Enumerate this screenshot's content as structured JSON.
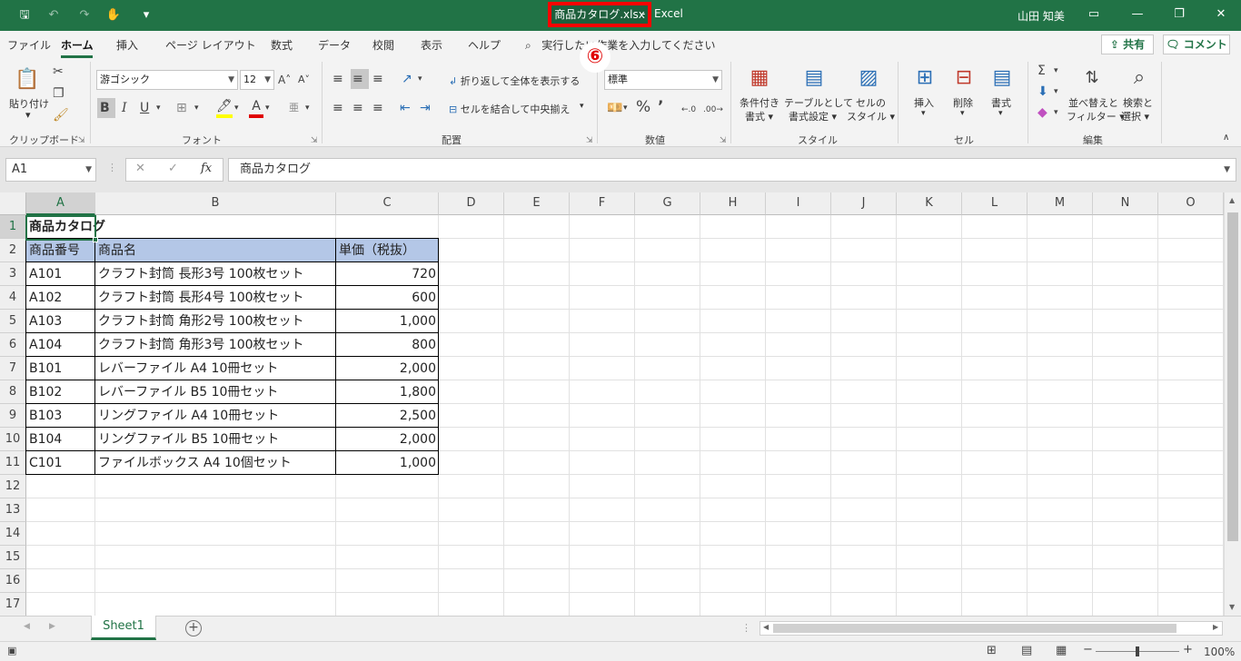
{
  "titlebar": {
    "file_name": "商品カタログ.xlsx",
    "separator": "-",
    "app_name": "Excel",
    "user": "山田 知美"
  },
  "menu": {
    "tabs": [
      "ファイル",
      "ホーム",
      "挿入",
      "ページ レイアウト",
      "数式",
      "データ",
      "校閲",
      "表示",
      "ヘルプ"
    ],
    "active_tab": "ホーム",
    "tell_me": "実行したい作業を入力してください",
    "share": "共有",
    "comment": "コメント",
    "step_marker": "⑥"
  },
  "ribbon": {
    "clipboard": {
      "paste": "貼り付け",
      "label": "クリップボード"
    },
    "font": {
      "name": "游ゴシック",
      "size": "12",
      "bold": "B",
      "italic": "I",
      "underline": "U",
      "label": "フォント"
    },
    "alignment": {
      "wrap": "折り返して全体を表示する",
      "merge": "セルを結合して中央揃え",
      "label": "配置"
    },
    "number": {
      "format": "標準",
      "label": "数値"
    },
    "styles": {
      "conditional": [
        "条件付き",
        "書式"
      ],
      "table": [
        "テーブルとして",
        "書式設定"
      ],
      "cell": [
        "セルの",
        "スタイル"
      ],
      "label": "スタイル"
    },
    "cells": {
      "insert": "挿入",
      "delete": "削除",
      "format": "書式",
      "label": "セル"
    },
    "editing": {
      "sort": [
        "並べ替えと",
        "フィルター"
      ],
      "find": [
        "検索と",
        "選択"
      ],
      "label": "編集"
    }
  },
  "formula_bar": {
    "name_box": "A1",
    "fx": "fx",
    "value": "商品カタログ"
  },
  "columns": [
    "A",
    "B",
    "C",
    "D",
    "E",
    "F",
    "G",
    "H",
    "I",
    "J",
    "K",
    "L",
    "M",
    "N",
    "O"
  ],
  "rows": [
    "1",
    "2",
    "3",
    "4",
    "5",
    "6",
    "7",
    "8",
    "9",
    "10",
    "11",
    "12",
    "13",
    "14",
    "15",
    "16",
    "17"
  ],
  "sheet": {
    "title": "商品カタログ",
    "headers": [
      "商品番号",
      "商品名",
      "単価（税抜）"
    ],
    "items": [
      {
        "code": "A101",
        "name": "クラフト封筒 長形3号 100枚セット",
        "price": "720"
      },
      {
        "code": "A102",
        "name": "クラフト封筒 長形4号 100枚セット",
        "price": "600"
      },
      {
        "code": "A103",
        "name": "クラフト封筒 角形2号 100枚セット",
        "price": "1,000"
      },
      {
        "code": "A104",
        "name": "クラフト封筒 角形3号 100枚セット",
        "price": "800"
      },
      {
        "code": "B101",
        "name": "レバーファイル A4 10冊セット",
        "price": "2,000"
      },
      {
        "code": "B102",
        "name": "レバーファイル B5 10冊セット",
        "price": "1,800"
      },
      {
        "code": "B103",
        "name": "リングファイル A4 10冊セット",
        "price": "2,500"
      },
      {
        "code": "B104",
        "name": "リングファイル B5 10冊セット",
        "price": "2,000"
      },
      {
        "code": "C101",
        "name": "ファイルボックス A4 10個セット",
        "price": "1,000"
      }
    ]
  },
  "sheet_tabs": {
    "active": "Sheet1"
  },
  "statusbar": {
    "zoom": "100%"
  },
  "colors": {
    "accent": "#217346",
    "header_fill": "#b4c7e7",
    "highlight": "#ff0000"
  }
}
